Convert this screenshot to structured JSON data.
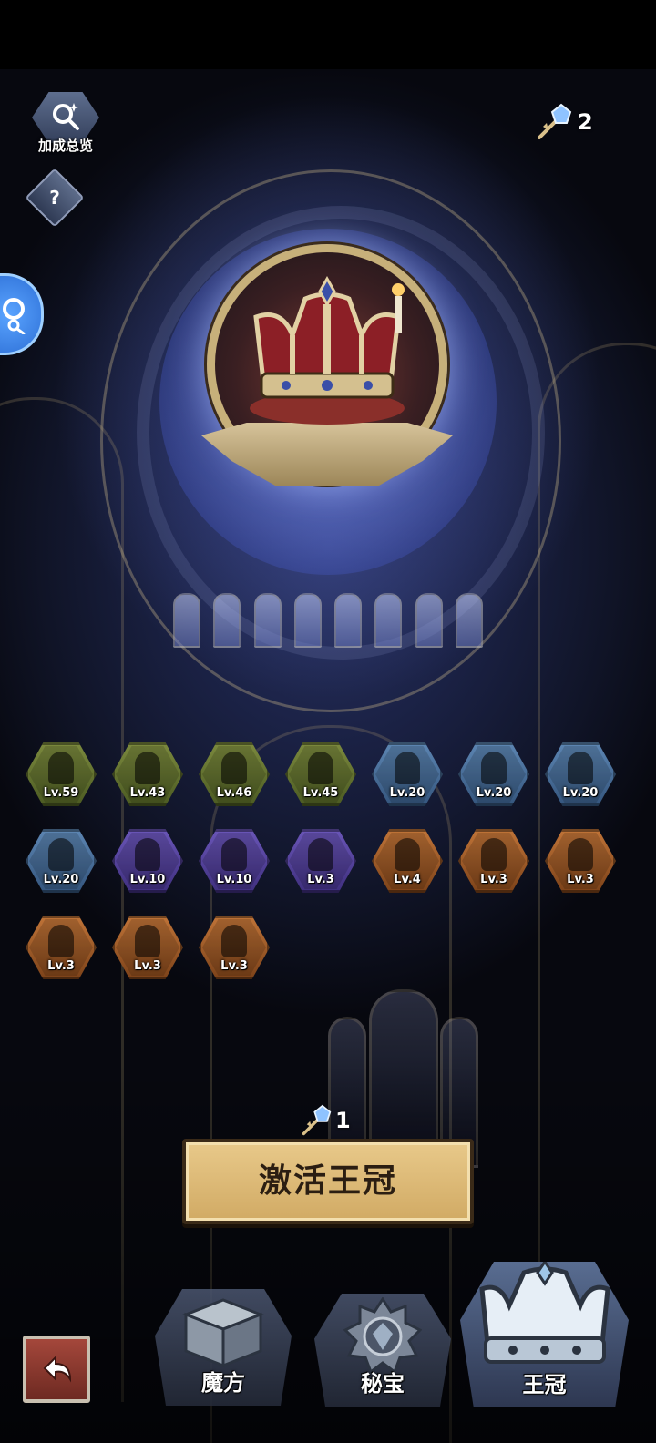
{
  "header": {
    "bonus_overview_label": "加成总览",
    "help_label": "?",
    "currency_icon": "crystal-key-icon",
    "currency_count": "2"
  },
  "crown_display": {
    "icon": "royal-crown-icon"
  },
  "relics": [
    {
      "level": "Lv.59",
      "icon": "humanoid-silhouette-icon",
      "color": "#6b7a33"
    },
    {
      "level": "Lv.43",
      "icon": "bone-icon",
      "color": "#6b7a33"
    },
    {
      "level": "Lv.46",
      "icon": "top-hat-figure-icon",
      "color": "#6b7a33"
    },
    {
      "level": "Lv.45",
      "icon": "ghost-icon",
      "color": "#6b7a33"
    },
    {
      "level": "Lv.20",
      "icon": "rabbit-icon",
      "color": "#4a73a0"
    },
    {
      "level": "Lv.20",
      "icon": "mask-head-icon",
      "color": "#4a73a0"
    },
    {
      "level": "Lv.20",
      "icon": "armor-icon",
      "color": "#4a73a0"
    },
    {
      "level": "Lv.20",
      "icon": "fish-icon",
      "color": "#4a73a0"
    },
    {
      "level": "Lv.10",
      "icon": "horned-helmet-icon",
      "color": "#5340a0"
    },
    {
      "level": "Lv.10",
      "icon": "wizard-hat-icon",
      "color": "#5340a0"
    },
    {
      "level": "Lv.3",
      "icon": "bunny-ears-icon",
      "color": "#5340a0"
    },
    {
      "level": "Lv.4",
      "icon": "octopus-icon",
      "color": "#a55e2a"
    },
    {
      "level": "Lv.3",
      "icon": "flame-icon",
      "color": "#a55e2a"
    },
    {
      "level": "Lv.3",
      "icon": "creature-icon",
      "color": "#a55e2a"
    },
    {
      "level": "Lv.3",
      "icon": "bat-icon",
      "color": "#a55e2a"
    },
    {
      "level": "Lv.3",
      "icon": "crown-icon",
      "color": "#a55e2a"
    },
    {
      "level": "Lv.3",
      "icon": "beast-head-icon",
      "color": "#a55e2a"
    }
  ],
  "activation": {
    "cost_icon": "crystal-key-icon",
    "cost": "1",
    "button_label": "激活王冠"
  },
  "bottom_nav": {
    "back_icon": "return-arrow-icon",
    "tabs": [
      {
        "label": "魔方",
        "icon": "cube-icon"
      },
      {
        "label": "秘宝",
        "icon": "gem-emblem-icon"
      },
      {
        "label": "王冠",
        "icon": "crown-icon",
        "active": true
      }
    ]
  }
}
